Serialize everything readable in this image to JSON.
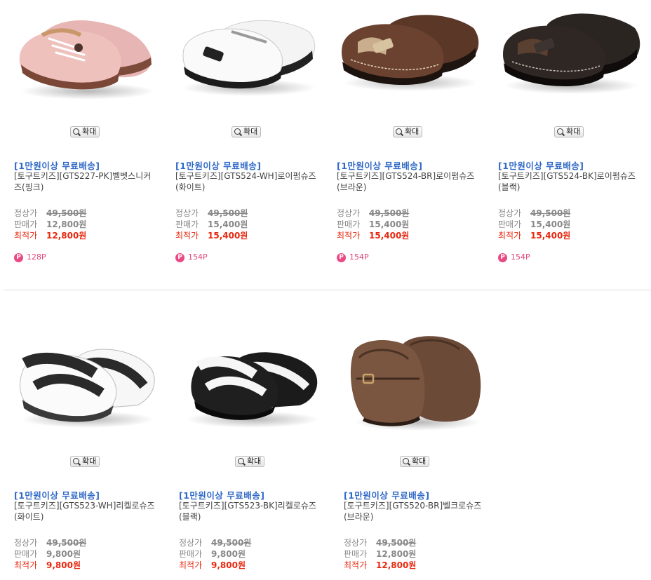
{
  "zoom_label": "확대",
  "price_labels": {
    "regular": "정상가",
    "sale": "판매가",
    "best": "최적가"
  },
  "colors": {
    "promo": "#2f68c7",
    "best_price": "#e8280f",
    "points": "#e0457a"
  },
  "products": [
    {
      "promo": "[1만원이상 무료배송]",
      "name": "[토구트키즈][GTS227-PK]벨벳스니커즈(핑크)",
      "regular": "49,500원",
      "sale": "12,800원",
      "best": "12,800원",
      "points": "128P"
    },
    {
      "promo": "[1만원이상 무료배송]",
      "name": "[토구트키즈][GTS524-WH]로이펌슈즈(화이트)",
      "regular": "49,500원",
      "sale": "15,400원",
      "best": "15,400원",
      "points": "154P"
    },
    {
      "promo": "[1만원이상 무료배송]",
      "name": "[토구트키즈][GTS524-BR]로이펌슈즈(브라운)",
      "regular": "49,500원",
      "sale": "15,400원",
      "best": "15,400원",
      "points": "154P"
    },
    {
      "promo": "[1만원이상 무료배송]",
      "name": "[토구트키즈][GTS524-BK]로이펌슈즈(블랙)",
      "regular": "49,500원",
      "sale": "15,400원",
      "best": "15,400원",
      "points": "154P"
    },
    {
      "promo": "[1만원이상 무료배송]",
      "name": "[토구트키즈][GTS523-WH]리켈로슈즈(화이트)",
      "regular": "49,500원",
      "sale": "9,800원",
      "best": "9,800원"
    },
    {
      "promo": "[1만원이상 무료배송]",
      "name": "[토구트키즈][GTS523-BK]리켈로슈즈(블랙)",
      "regular": "49,500원",
      "sale": "9,800원",
      "best": "9,800원"
    },
    {
      "promo": "[1만원이상 무료배송]",
      "name": "[토구트키즈][GTS520-BR]벨크로슈즈(브라운)",
      "regular": "49,500원",
      "sale": "12,800원",
      "best": "12,800원"
    }
  ]
}
